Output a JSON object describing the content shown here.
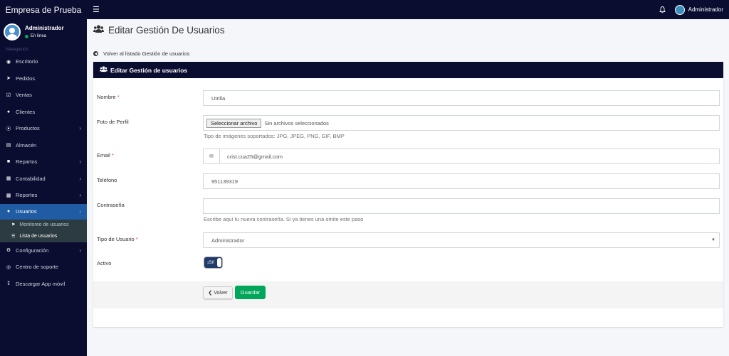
{
  "app": {
    "brand": "Empresa de Prueba",
    "top_user": "Administrador"
  },
  "sidebar": {
    "user_name": "Administrador",
    "status": "En línea",
    "nav_header": "Navegación",
    "items": [
      {
        "label": "Escritorio",
        "icon": "dashboard-icon"
      },
      {
        "label": "Pedidos",
        "icon": "paper-plane-icon"
      },
      {
        "label": "Ventas",
        "icon": "checkbox-icon"
      },
      {
        "label": "Clientes",
        "icon": "users-icon"
      },
      {
        "label": "Productos",
        "icon": "circle-icon",
        "chevron": "›"
      },
      {
        "label": "Almacén",
        "icon": "file-icon"
      },
      {
        "label": "Repartos",
        "icon": "truck-icon",
        "chevron": "›"
      },
      {
        "label": "Contabilidad",
        "icon": "calculator-icon",
        "chevron": "›"
      },
      {
        "label": "Reportes",
        "icon": "bar-chart-icon",
        "chevron": "›"
      },
      {
        "label": "Usuarios",
        "icon": "user-icon",
        "chevron": "›"
      },
      {
        "label": "Configuración",
        "icon": "gears-icon",
        "chevron": "›"
      },
      {
        "label": "Centro de soporte",
        "icon": "lifebuoy-icon"
      },
      {
        "label": "Descargar App móvil",
        "icon": "download-icon"
      }
    ],
    "submenu": [
      {
        "label": "Monitoreo de usuarios"
      },
      {
        "label": "Lista de usuarios"
      }
    ]
  },
  "page": {
    "title": "Editar Gestión De Usuarios",
    "back_link": "Volver al listado Gestión de usuarios",
    "panel_title": "Editar Gestión de usuarios"
  },
  "form": {
    "nombre_label": "Nombre",
    "nombre_value": "Utrilla",
    "foto_label": "Foto de Perfil",
    "file_button": "Seleccionar archivo",
    "file_status": "Sin archivos seleccionados",
    "foto_help": "Tipo de imágenes soportados: JPG, JPEG, PNG, GIF, BMP",
    "email_label": "Email",
    "email_value": "crist.cua25@gmail.com",
    "telefono_label": "Teléfono",
    "telefono_value": "951139319",
    "password_label": "Contraseña",
    "password_help": "Escribe aquí tu nueva contraseña. Si ya tienes una omite este paso",
    "tipo_label": "Tipo de Usuario",
    "tipo_value": "Administrador",
    "activo_label": "Activo",
    "activo_value": "¡Sí!",
    "required_mark": "*"
  },
  "buttons": {
    "back": "Volver",
    "save": "Guardar"
  },
  "colors": {
    "navy": "#0a0c30",
    "active_blue": "#1f5ca4",
    "green": "#00a65a",
    "required": "#dd4b39"
  }
}
